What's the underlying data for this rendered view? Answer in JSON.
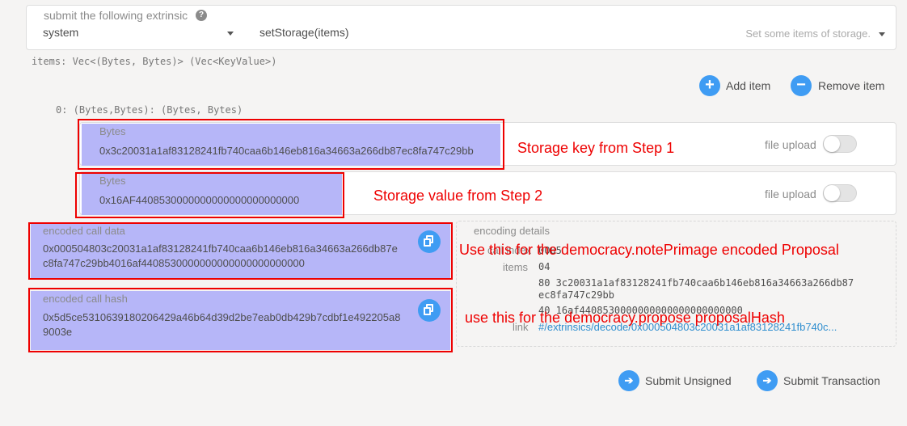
{
  "extrinsic": {
    "label": "submit the following extrinsic",
    "help_icon": "?",
    "module": "system",
    "method": "setStorage(items)",
    "description": "Set some items of storage."
  },
  "params": {
    "items_type": "items: Vec<(Bytes, Bytes)> (Vec<KeyValue>)",
    "add_item": "Add item",
    "remove_item": "Remove item",
    "add_icon": "+",
    "remove_icon": "−",
    "tuple_label": "0: (Bytes,Bytes): (Bytes, Bytes)",
    "fields": [
      {
        "label": "Bytes",
        "value": "0x3c20031a1af83128241fb740caa6b146eb816a34663a266db87ec8fa747c29bb",
        "file_upload": "file upload",
        "annotation": "Storage key from Step 1"
      },
      {
        "label": "Bytes",
        "value": "0x16AF4408530000000000000000000000",
        "file_upload": "file upload",
        "annotation": "Storage value from Step 2"
      }
    ]
  },
  "encoded": {
    "call_data_label": "encoded call data",
    "call_data_line1": "0x000504803c20031a1af83128241fb740caa6b146eb816a34663a266db87e",
    "call_data_line2": "c8fa747c29bb4016af4408530000000000000000000000",
    "call_data_annotation": "Use this for the democracy.notePrimage encoded Proposal",
    "call_hash_label": "encoded call hash",
    "call_hash_line1": "0x5d5ce5310639180206429a46b64d39d2be7eab0db429b7cdbf1e492205a8",
    "call_hash_line2": "9003e",
    "call_hash_annotation": "use this for the democracy.propose proposalHash"
  },
  "details": {
    "title": "encoding details",
    "call_index_label": "call index",
    "call_index_value": "0005",
    "items_label": "items",
    "items_count": "04",
    "item1_line1": "80 3c20031a1af83128241fb740caa6b146eb816a34663a266db87",
    "item1_line2": "ec8fa747c29bb",
    "item2": "40 16af4408530000000000000000000000",
    "link_label": "link",
    "link_value": "#/extrinsics/decode/0x000504803c20031a1af83128241fb740c..."
  },
  "actions": {
    "submit_unsigned": "Submit Unsigned",
    "submit_transaction": "Submit Transaction",
    "submit_icon": "➔"
  }
}
